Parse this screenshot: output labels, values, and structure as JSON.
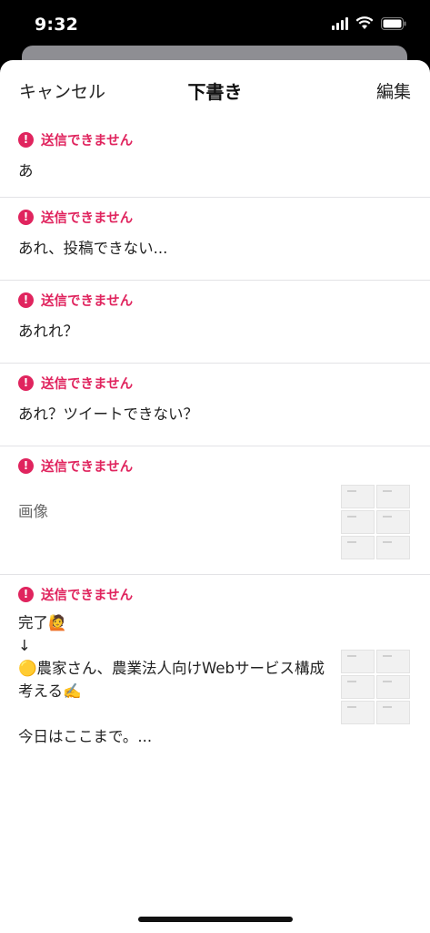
{
  "status_bar": {
    "time": "9:32"
  },
  "nav": {
    "cancel": "キャンセル",
    "title": "下書き",
    "edit": "編集"
  },
  "error_label": "送信できません",
  "drafts": [
    {
      "text": "あ"
    },
    {
      "text": "あれ、投稿できない..."
    },
    {
      "text": "あれれ？"
    },
    {
      "text": "あれ？ツイートできない？"
    },
    {
      "text": "画像"
    },
    {
      "text": "完了🙋\n↓\n🟡農家さん、農業法人向けWebサービス構成考える✍️\n\n今日はここまで。..."
    }
  ],
  "colors": {
    "error": "#e0245e",
    "divider": "#e3e3e6"
  }
}
